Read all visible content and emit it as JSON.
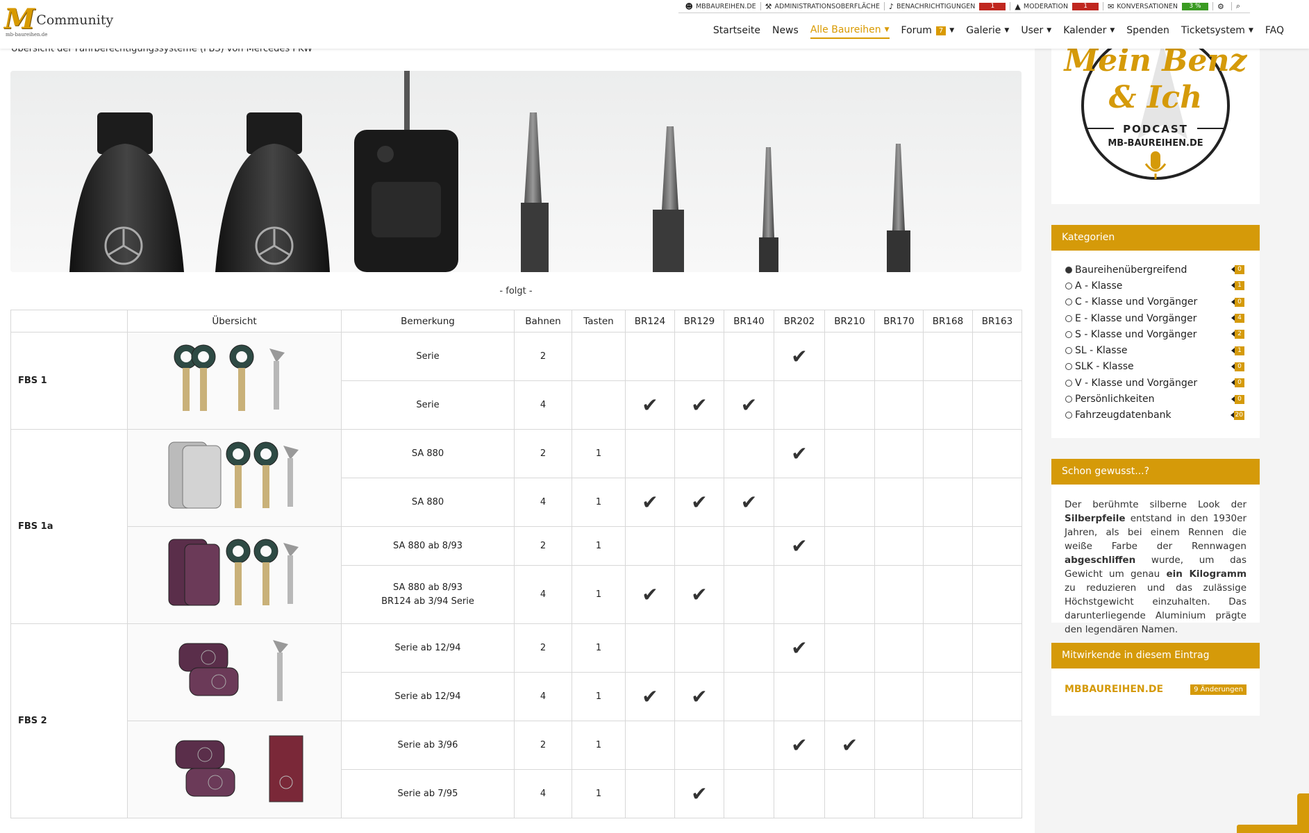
{
  "header": {
    "logo_mark": "M",
    "logo_sub": "mb-baureihen.de",
    "logo_word": "Community",
    "userbar": [
      {
        "icon": "user-icon",
        "glyph": "☻",
        "label": "MBBAUREIHEN.DE"
      },
      {
        "icon": "wrench-icon",
        "glyph": "⚒",
        "label": "ADMINISTRATIONSOBERFLÄCHE"
      },
      {
        "icon": "bell-icon",
        "glyph": "♪",
        "label": "BENACHRICHTIGUNGEN",
        "count": "1",
        "count_color": "red"
      },
      {
        "icon": "warning-icon",
        "glyph": "▲",
        "label": "MODERATION",
        "count": "1",
        "count_color": "red"
      },
      {
        "icon": "chat-icon",
        "glyph": "✉",
        "label": "KONVERSATIONEN",
        "count": "3 %",
        "count_color": "green"
      },
      {
        "icon": "gear-icon",
        "glyph": "⚙",
        "label": ""
      },
      {
        "icon": "search-icon",
        "glyph": "⌕",
        "label": ""
      }
    ],
    "nav": [
      {
        "label": "Startseite"
      },
      {
        "label": "News"
      },
      {
        "label": "Alle Baureihen",
        "caret": true,
        "active": true
      },
      {
        "label": "Forum",
        "badge": "7",
        "caret": true
      },
      {
        "label": "Galerie",
        "caret": true
      },
      {
        "label": "User",
        "caret": true
      },
      {
        "label": "Kalender",
        "caret": true
      },
      {
        "label": "Spenden"
      },
      {
        "label": "Ticketsystem",
        "caret": true
      },
      {
        "label": "FAQ"
      }
    ]
  },
  "main": {
    "subtitle": "Übersicht der Fahrberechtigungssysteme (FBS) von Mercedes PKW",
    "placeholder": "- folgt -",
    "table": {
      "headers": [
        "",
        "Übersicht",
        "Bemerkung",
        "Bahnen",
        "Tasten",
        "BR124",
        "BR129",
        "BR140",
        "BR202",
        "BR210",
        "BR170",
        "BR168",
        "BR163"
      ],
      "rows": [
        {
          "group": "FBS 1",
          "span": 2,
          "img": "fbs1",
          "img_span": 2,
          "bem": "Serie",
          "bahnen": "2",
          "tasten": "",
          "checks": [
            0,
            0,
            0,
            1,
            0,
            0,
            0,
            0
          ],
          "h": 70
        },
        {
          "bem": "Serie",
          "bahnen": "4",
          "tasten": "",
          "checks": [
            1,
            1,
            1,
            0,
            0,
            0,
            0,
            0
          ],
          "h": 70
        },
        {
          "group": "FBS 1a",
          "span": 4,
          "img": "fbs1a-silver",
          "img_span": 2,
          "bem": "SA 880",
          "bahnen": "2",
          "tasten": "1",
          "checks": [
            0,
            0,
            0,
            1,
            0,
            0,
            0,
            0
          ],
          "h": 70
        },
        {
          "bem": "SA 880",
          "bahnen": "4",
          "tasten": "1",
          "checks": [
            1,
            1,
            1,
            0,
            0,
            0,
            0,
            0
          ],
          "h": 70
        },
        {
          "img": "fbs1a-purple",
          "img_span": 2,
          "bem": "SA 880 ab 8/93",
          "bahnen": "2",
          "tasten": "1",
          "checks": [
            0,
            0,
            0,
            1,
            0,
            0,
            0,
            0
          ],
          "h": 56
        },
        {
          "bem": "SA 880 ab 8/93\nBR124 ab 3/94 Serie",
          "bahnen": "4",
          "tasten": "1",
          "checks": [
            1,
            1,
            0,
            0,
            0,
            0,
            0,
            0
          ],
          "h": 84
        },
        {
          "group": "FBS 2",
          "span": 4,
          "img": "fbs2-a",
          "img_span": 2,
          "bem": "Serie ab 12/94",
          "bahnen": "2",
          "tasten": "1",
          "checks": [
            0,
            0,
            0,
            1,
            0,
            0,
            0,
            0
          ],
          "h": 70
        },
        {
          "bem": "Serie ab 12/94",
          "bahnen": "4",
          "tasten": "1",
          "checks": [
            1,
            1,
            0,
            0,
            0,
            0,
            0,
            0
          ],
          "h": 70
        },
        {
          "img": "fbs2-b",
          "img_span": 2,
          "bem": "Serie ab 3/96",
          "bahnen": "2",
          "tasten": "1",
          "checks": [
            0,
            0,
            0,
            1,
            1,
            0,
            0,
            0
          ],
          "h": 70
        },
        {
          "bem": "Serie ab 7/95",
          "bahnen": "4",
          "tasten": "1",
          "checks": [
            0,
            1,
            0,
            0,
            0,
            0,
            0,
            0
          ],
          "h": 70
        }
      ]
    }
  },
  "sidebar": {
    "podcast": {
      "line1": "Mein Benz",
      "line2": "& Ich",
      "line3": "PODCAST",
      "line4": "MB-BAUREIHEN.DE"
    },
    "categories": {
      "title": "Kategorien",
      "items": [
        {
          "label": "Baureihenübergreifend",
          "count": "0",
          "selected": true
        },
        {
          "label": "A - Klasse",
          "count": "1"
        },
        {
          "label": "C - Klasse und Vorgänger",
          "count": "0"
        },
        {
          "label": "E - Klasse und Vorgänger",
          "count": "4"
        },
        {
          "label": "S - Klasse und Vorgänger",
          "count": "2"
        },
        {
          "label": "SL - Klasse",
          "count": "1"
        },
        {
          "label": "SLK - Klasse",
          "count": "0"
        },
        {
          "label": "V - Klasse und Vorgänger",
          "count": "0"
        },
        {
          "label": "Persönlichkeiten",
          "count": "0"
        },
        {
          "label": "Fahrzeugdatenbank",
          "count": "20"
        }
      ]
    },
    "didyouknow": {
      "title": "Schon gewusst...?",
      "parts": [
        {
          "t": "Der berühmte silberne Look der "
        },
        {
          "t": "Silberpfeile",
          "b": true
        },
        {
          "t": " entstand in den 1930er Jahren, als bei einem Rennen die weiße Farbe der Rennwagen "
        },
        {
          "t": "abgeschliffen",
          "b": true
        },
        {
          "t": " wurde, um das Gewicht um genau "
        },
        {
          "t": "ein Kilogramm",
          "b": true
        },
        {
          "t": " zu reduzieren und das zulässige Höchstgewicht einzuhalten. Das darunterliegende Aluminium prägte den legendären Namen."
        }
      ]
    },
    "contributors": {
      "title": "Mitwirkende in diesem Eintrag",
      "name": "MBBAUREIHEN.DE",
      "changes": "9 Änderungen"
    }
  },
  "colors": {
    "accent": "#d59a09",
    "red": "#c0271f",
    "green": "#3a9b22"
  }
}
